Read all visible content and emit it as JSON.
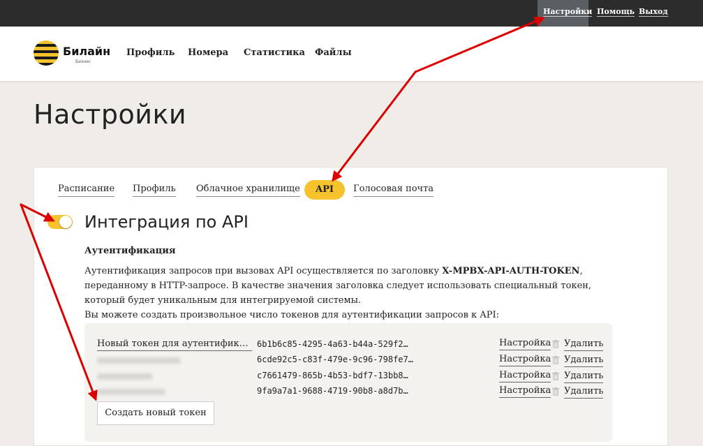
{
  "topbar": {
    "settings": "Настройки",
    "help": "Помощь",
    "logout": "Выход"
  },
  "header": {
    "logo_name": "Билайн",
    "logo_sub": "Бизнес",
    "nav": [
      "Профиль",
      "Номера",
      "Статистика",
      "Файлы"
    ]
  },
  "page_title": "Настройки",
  "tabs": [
    "Расписание",
    "Профиль",
    "Облачное хранилище",
    "API",
    "Голосовая почта"
  ],
  "active_tab": "API",
  "section": {
    "title": "Интеграция по API",
    "toggle_on": true,
    "subheading": "Аутентификация",
    "desc_part1": "Аутентификация запросов при вызовах API осуществляется по заголовку ",
    "desc_header": "X-MPBX-API-AUTH-TOKEN",
    "desc_part2": ", переданному в HTTP-запросе. В качестве значения заголовка следует использовать специальный токен, который будет уникальным для интегрируемой системы.",
    "desc_line2": "Вы можете создать произвольное число токенов для аутентификации запросов к API:"
  },
  "tokens": [
    {
      "name": "Новый токен для аутентификации запросов",
      "value": "6b1b6c85-4295-4a63-b44a-529f2…"
    },
    {
      "name": "",
      "value": "6cde92c5-c83f-479e-9c96-798fe7…"
    },
    {
      "name": "",
      "value": "c7661479-865b-4b53-bdf7-13bb8…"
    },
    {
      "name": "",
      "value": "9fa9a7a1-9688-4719-90b8-a8d7b…"
    }
  ],
  "token_actions": {
    "settings": "Настройка",
    "delete": "Удалить"
  },
  "create_button": "Создать новый токен",
  "colors": {
    "accent": "#f6c22d",
    "topbar": "#2c2c2c",
    "annotation": "#dd0000"
  }
}
